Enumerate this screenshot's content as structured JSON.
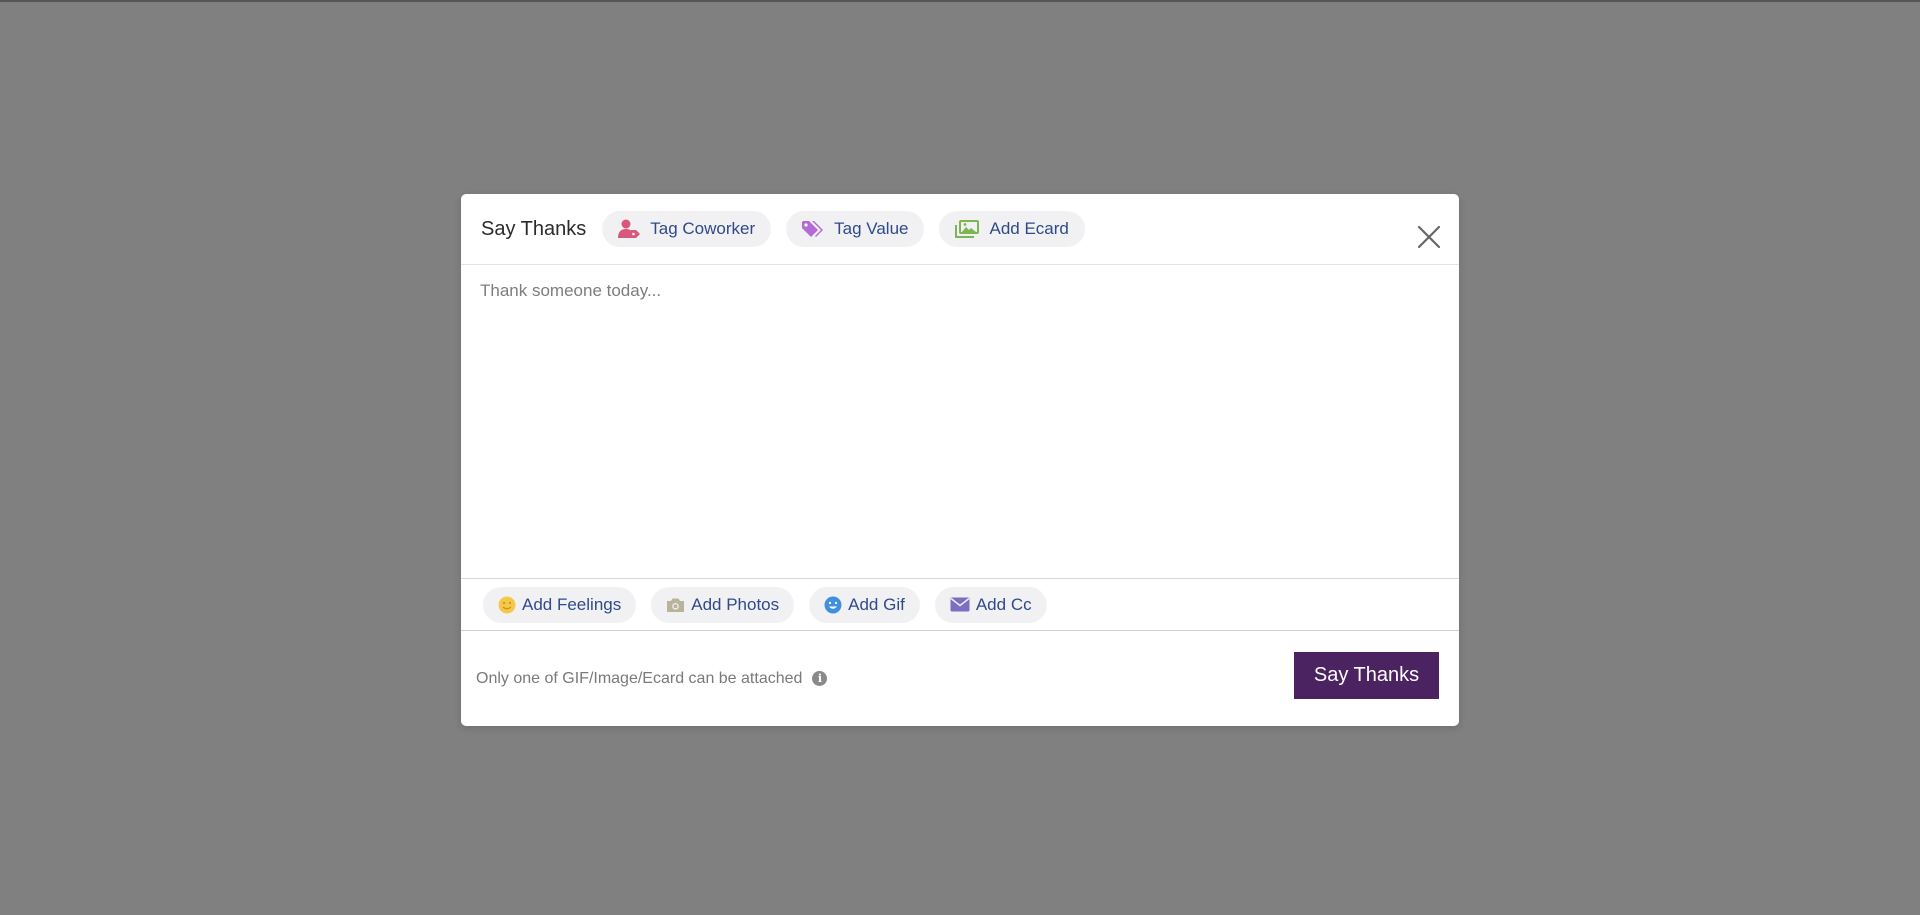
{
  "modal": {
    "title": "Say Thanks",
    "header_actions": [
      {
        "label": "Tag Coworker",
        "icon": "user-tag-icon",
        "color": "#d9577a"
      },
      {
        "label": "Tag Value",
        "icon": "tag-icon",
        "color": "#b46bd8"
      },
      {
        "label": "Add Ecard",
        "icon": "images-icon",
        "color": "#7cb552"
      }
    ],
    "message": {
      "placeholder": "Thank someone today...",
      "value": ""
    },
    "toolbar": [
      {
        "label": "Add Feelings",
        "icon": "smiley-icon",
        "color": "#f5c84a"
      },
      {
        "label": "Add Photos",
        "icon": "camera-icon",
        "color": "#b8b39a"
      },
      {
        "label": "Add Gif",
        "icon": "gif-smiley-icon",
        "color": "#3f8fe0"
      },
      {
        "label": "Add Cc",
        "icon": "envelope-icon",
        "color": "#7a6fc2"
      }
    ],
    "footer": {
      "note": "Only one of GIF/Image/Ecard can be attached",
      "info_glyph": "i",
      "submit_label": "Say Thanks"
    }
  },
  "colors": {
    "overlay": "#808080",
    "primary_button": "#4b2361",
    "link_text": "#2f4a8a"
  }
}
